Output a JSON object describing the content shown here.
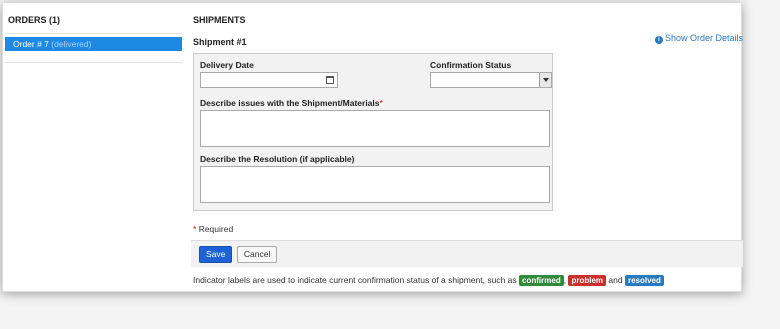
{
  "sidebar": {
    "title": "ORDERS (1)",
    "orders": [
      {
        "label": "Order # 7",
        "status": "(delivered)"
      }
    ]
  },
  "main": {
    "title": "SHIPMENTS",
    "show_details": "Show Order Details",
    "shipment_label": "Shipment #1",
    "fields": {
      "delivery_date_label": "Delivery Date",
      "delivery_date_value": "",
      "confirmation_label": "Confirmation Status",
      "confirmation_value": "",
      "issues_label": "Describe issues with the Shipment/Materials",
      "issues_required_mark": "*",
      "resolution_label": "Describe the Resolution (if applicable)"
    },
    "required_mark": "*",
    "required_text": "Required",
    "buttons": {
      "save": "Save",
      "cancel": "Cancel"
    },
    "indicator": {
      "prefix": "Indicator labels are used to indicate current confirmation status of a shipment, such as",
      "sep1": ",",
      "sep2": "and",
      "labels": [
        {
          "text": "confirmed",
          "color": "#2e8b3a"
        },
        {
          "text": "problem",
          "color": "#c9302c"
        },
        {
          "text": "resolved",
          "color": "#2a7ac0"
        }
      ]
    }
  }
}
